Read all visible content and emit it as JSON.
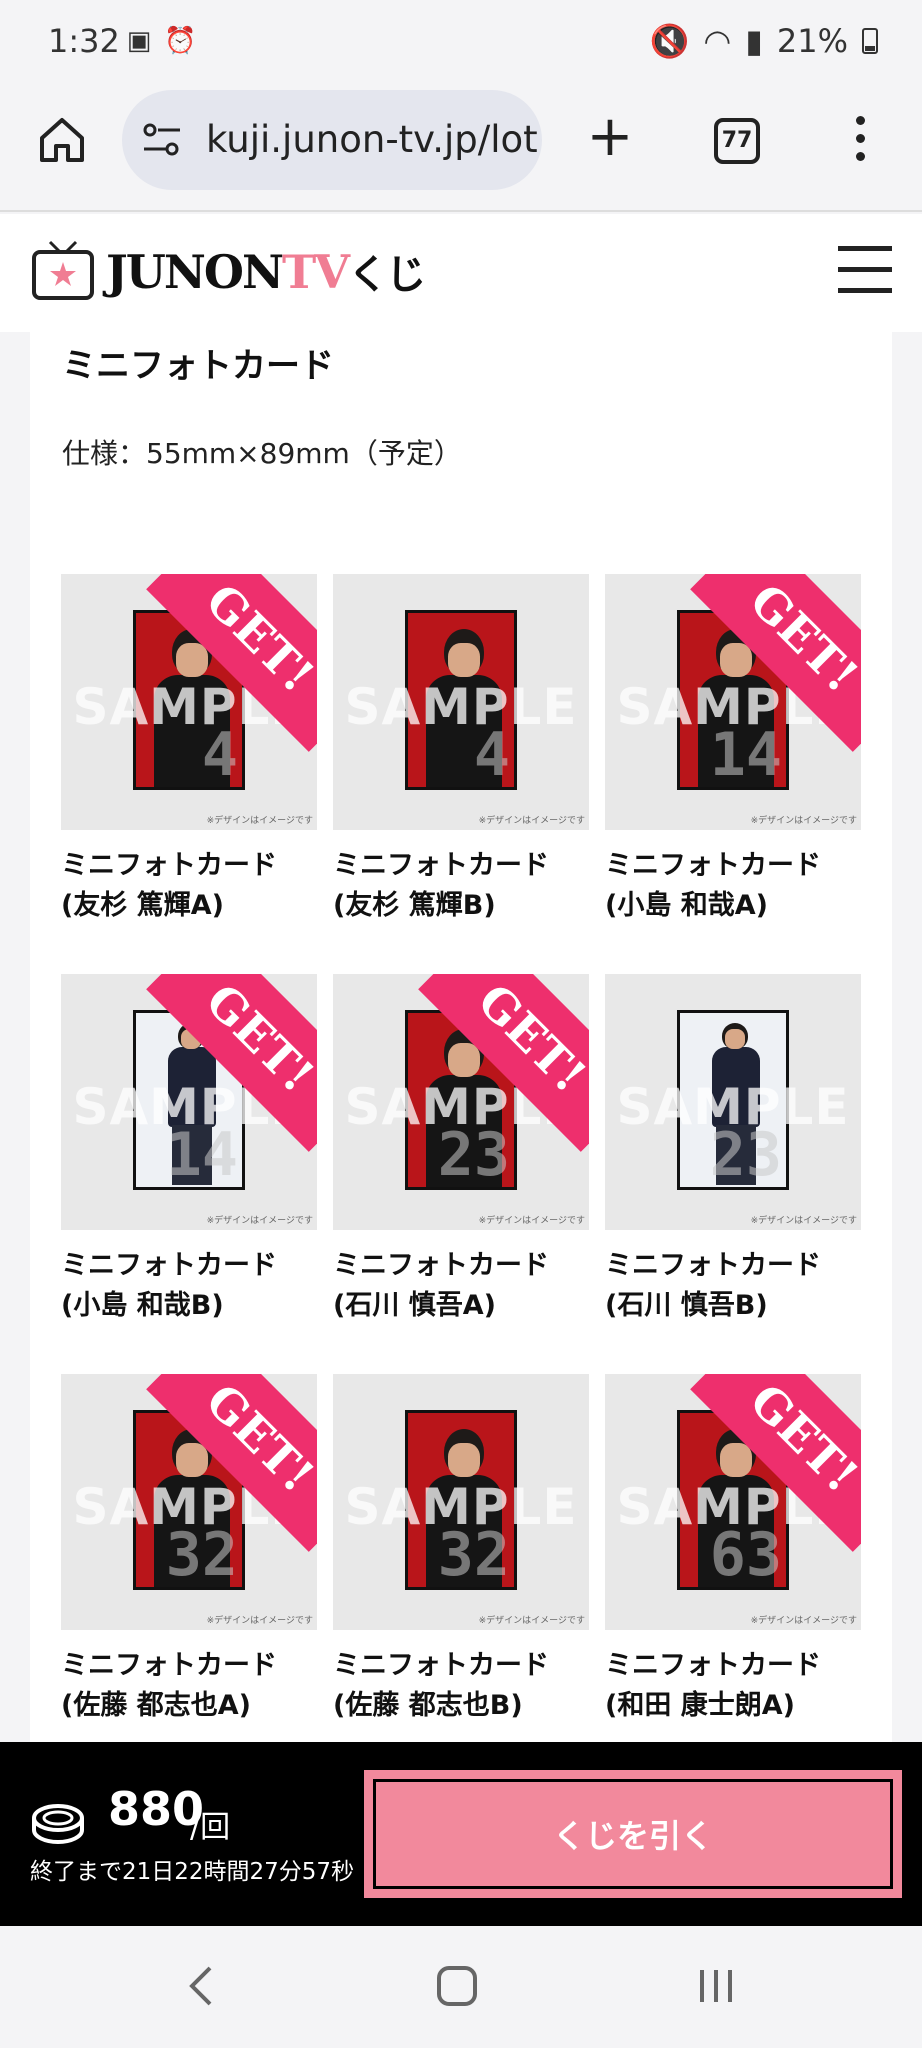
{
  "status": {
    "time": "1:32",
    "battery": "21%"
  },
  "browser": {
    "url": "kuji.junon-tv.jp/lot",
    "tab_count": "77"
  },
  "site": {
    "logo_main": "JUNON",
    "logo_tv": "TV",
    "logo_kuji": "くじ"
  },
  "section": {
    "title": "ミニフォトカード",
    "spec": "仕様：55mm×89mm（予定）"
  },
  "items": [
    {
      "line1": "ミニフォトカード",
      "line2": "(友杉 篤輝A)",
      "number": "4",
      "got": true
    },
    {
      "line1": "ミニフォトカード",
      "line2": "(友杉 篤輝B)",
      "number": "4",
      "got": false
    },
    {
      "line1": "ミニフォトカード",
      "line2": "(小島 和哉A)",
      "number": "14",
      "got": true
    },
    {
      "line1": "ミニフォトカード",
      "line2": "(小島 和哉B)",
      "number": "14",
      "got": true
    },
    {
      "line1": "ミニフォトカード",
      "line2": "(石川 慎吾A)",
      "number": "23",
      "got": true
    },
    {
      "line1": "ミニフォトカード",
      "line2": "(石川 慎吾B)",
      "number": "23",
      "got": false
    },
    {
      "line1": "ミニフォトカード",
      "line2": "(佐藤 都志也A)",
      "number": "32",
      "got": true
    },
    {
      "line1": "ミニフォトカード",
      "line2": "(佐藤 都志也B)",
      "number": "32",
      "got": false
    },
    {
      "line1": "ミニフォトカード",
      "line2": "(和田 康士朗A)",
      "number": "63",
      "got": true
    }
  ],
  "thumb_text": {
    "sample": "SAMPLE",
    "get": "GET!",
    "note": "※デザインはイメージです"
  },
  "purchase": {
    "price": "880",
    "per": "/回",
    "remaining": "終了まで21日22時間27分57秒",
    "button": "くじを引く"
  },
  "colors": {
    "accent_pink": "#f2899c",
    "get_pink": "#ee2f6d"
  }
}
